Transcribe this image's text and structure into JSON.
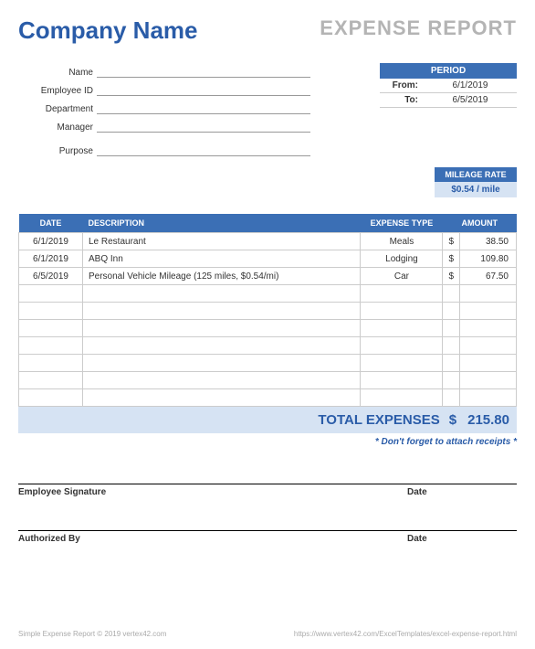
{
  "header": {
    "company": "Company Name",
    "title": "EXPENSE REPORT"
  },
  "fields": {
    "name_label": "Name",
    "employee_id_label": "Employee ID",
    "department_label": "Department",
    "manager_label": "Manager",
    "purpose_label": "Purpose"
  },
  "period": {
    "header": "PERIOD",
    "from_label": "From:",
    "to_label": "To:",
    "from": "6/1/2019",
    "to": "6/5/2019"
  },
  "mileage": {
    "header": "MILEAGE RATE",
    "value": "$0.54 / mile"
  },
  "table": {
    "headers": {
      "date": "DATE",
      "description": "DESCRIPTION",
      "type": "EXPENSE TYPE",
      "amount": "AMOUNT"
    },
    "rows": [
      {
        "date": "6/1/2019",
        "desc": "Le Restaurant",
        "type": "Meals",
        "cur": "$",
        "amt": "38.50"
      },
      {
        "date": "6/1/2019",
        "desc": "ABQ Inn",
        "type": "Lodging",
        "cur": "$",
        "amt": "109.80"
      },
      {
        "date": "6/5/2019",
        "desc": "Personal Vehicle Mileage (125 miles, $0.54/mi)",
        "type": "Car",
        "cur": "$",
        "amt": "67.50"
      },
      {
        "date": "",
        "desc": "",
        "type": "",
        "cur": "",
        "amt": ""
      },
      {
        "date": "",
        "desc": "",
        "type": "",
        "cur": "",
        "amt": ""
      },
      {
        "date": "",
        "desc": "",
        "type": "",
        "cur": "",
        "amt": ""
      },
      {
        "date": "",
        "desc": "",
        "type": "",
        "cur": "",
        "amt": ""
      },
      {
        "date": "",
        "desc": "",
        "type": "",
        "cur": "",
        "amt": ""
      },
      {
        "date": "",
        "desc": "",
        "type": "",
        "cur": "",
        "amt": ""
      },
      {
        "date": "",
        "desc": "",
        "type": "",
        "cur": "",
        "amt": ""
      }
    ]
  },
  "total": {
    "label": "TOTAL EXPENSES",
    "cur": "$",
    "amt": "215.80"
  },
  "note": "* Don't forget to attach receipts *",
  "signatures": {
    "employee": "Employee Signature",
    "authorized": "Authorized By",
    "date": "Date"
  },
  "footer": {
    "left": "Simple Expense Report © 2019 vertex42.com",
    "right": "https://www.vertex42.com/ExcelTemplates/excel-expense-report.html"
  }
}
